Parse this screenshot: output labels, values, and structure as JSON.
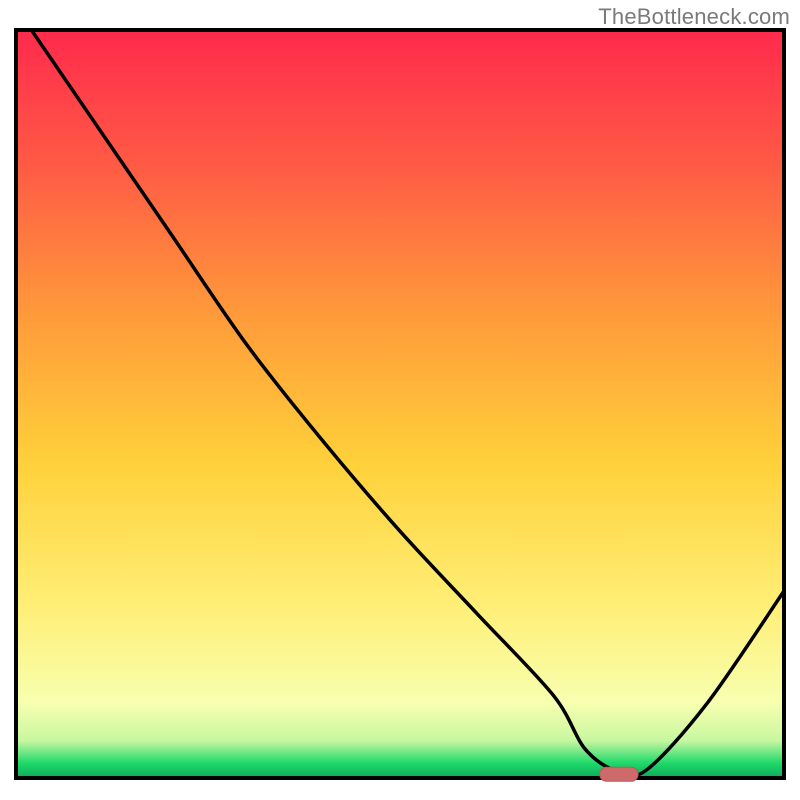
{
  "watermark": "TheBottleneck.com",
  "colors": {
    "frame": "#000000",
    "curve": "#000000",
    "marker_fill": "#cf6a6a",
    "marker_stroke": "#b95a5a",
    "gradient_top": "#ff2a4d",
    "gradient_mid_upper": "#ff8a3a",
    "gradient_mid": "#ffd13a",
    "gradient_mid_lower": "#fff07a",
    "gradient_low": "#f7ffb0",
    "gradient_green": "#1fd96a",
    "gradient_bottom": "#0ea85a"
  },
  "chart_data": {
    "type": "line",
    "title": "",
    "xlabel": "",
    "ylabel": "",
    "xlim": [
      0,
      100
    ],
    "ylim": [
      0,
      100
    ],
    "grid": false,
    "legend": false,
    "x": [
      2,
      10,
      20,
      30,
      40,
      50,
      60,
      70,
      74,
      78,
      82,
      90,
      100
    ],
    "values": [
      100,
      88,
      73,
      58,
      45,
      33,
      22,
      11,
      4,
      1,
      1,
      10,
      25
    ],
    "optimum_marker": {
      "x_start": 76,
      "x_end": 81,
      "y": 0.5
    },
    "notes": "V-shaped bottleneck curve on a red→green vertical gradient. Minimum (optimal point) near x≈78% where the curve reaches ~0%, marked with a small pink pill on the baseline."
  }
}
